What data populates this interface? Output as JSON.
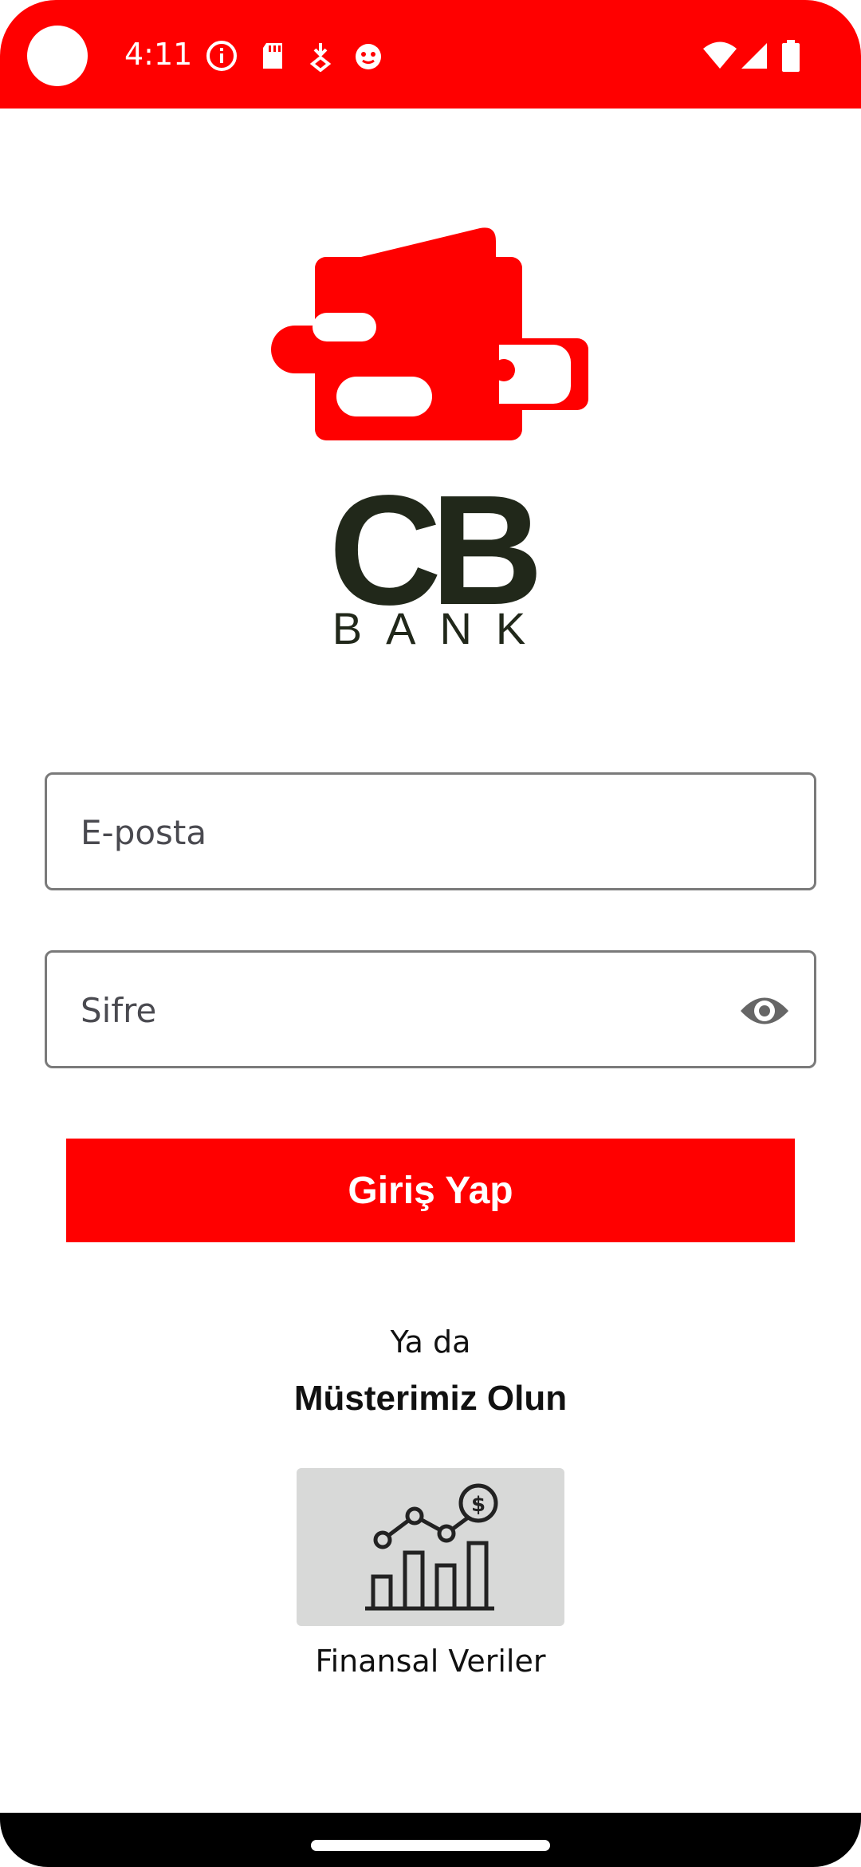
{
  "status_bar": {
    "time": "4:11",
    "color": "#ff0000",
    "left_icons": [
      "info-icon",
      "sd-card-icon",
      "download-icon",
      "notification-icon"
    ],
    "right_icons": [
      "wifi-icon",
      "signal-icon",
      "battery-icon"
    ]
  },
  "brand": {
    "logo_icon": "wallet-icon",
    "name": "CB",
    "subtitle": "BANK",
    "accent_color": "#ff0000",
    "text_color": "#21281a"
  },
  "login_form": {
    "email_placeholder": "E-posta",
    "password_placeholder": "Sifre",
    "password_toggle_icon": "eye-icon",
    "submit_label": "Giriş Yap"
  },
  "alt_actions": {
    "or_text": "Ya da",
    "signup_label": "Müsterimiz Olun"
  },
  "finance": {
    "icon": "finance-chart-icon",
    "label": "Finansal Veriler"
  }
}
